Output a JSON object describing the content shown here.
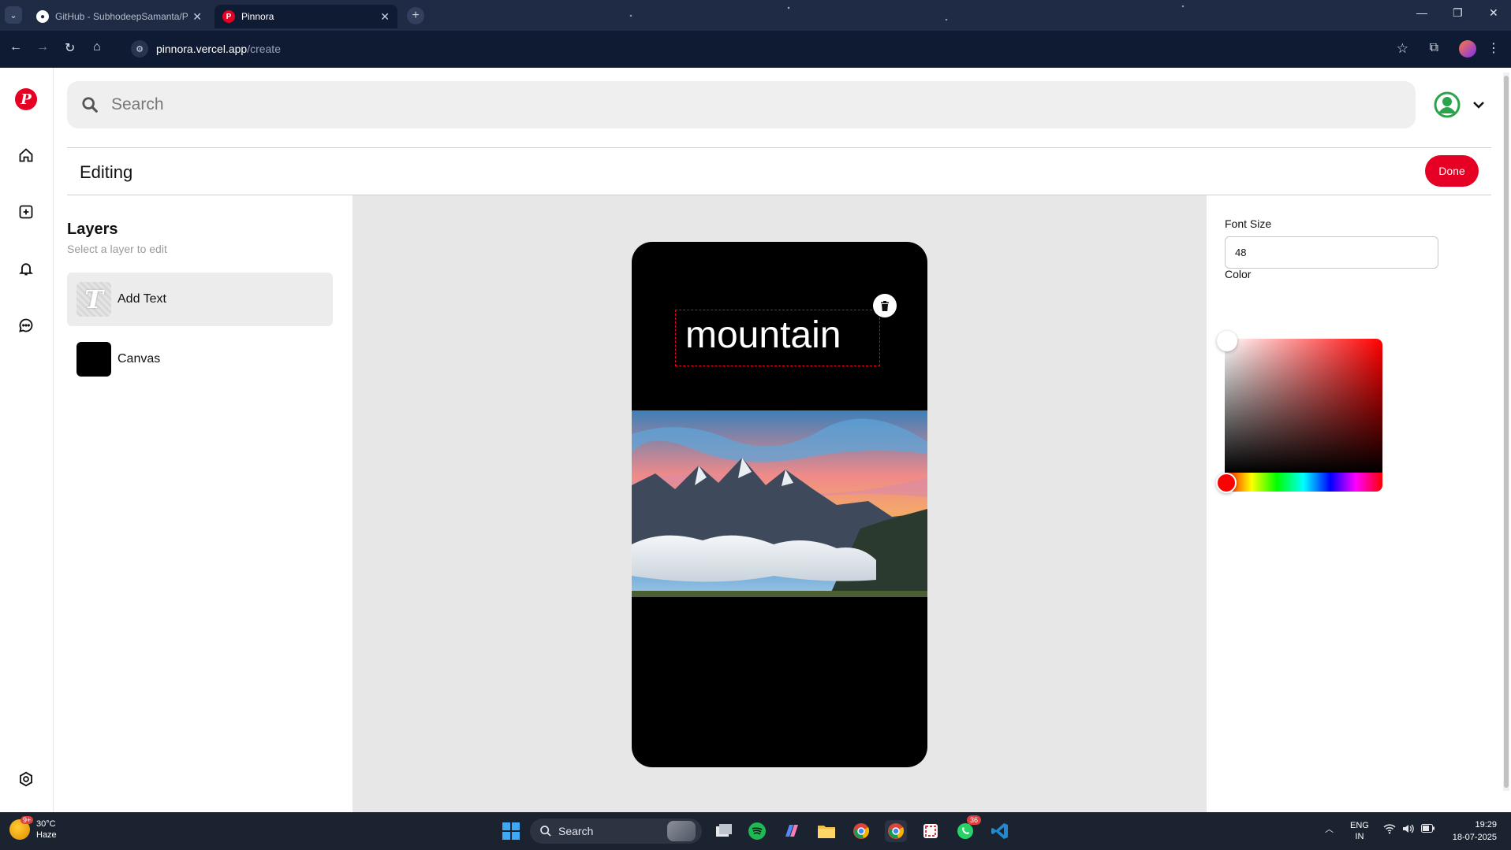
{
  "browser": {
    "tabs": [
      {
        "title": "GitHub - SubhodeepSamanta/P",
        "active": false
      },
      {
        "title": "Pinnora",
        "active": true
      }
    ],
    "url_host": "pinnora.vercel.app",
    "url_path": "/create"
  },
  "app": {
    "search_placeholder": "Search",
    "editing_title": "Editing",
    "done_label": "Done",
    "layers": {
      "title": "Layers",
      "subtitle": "Select a layer to edit",
      "items": [
        {
          "label": "Add Text",
          "selected": true
        },
        {
          "label": "Canvas",
          "selected": false
        }
      ]
    },
    "canvas": {
      "text_layer": "mountain",
      "background": "#000000"
    },
    "properties": {
      "font_size_label": "Font Size",
      "font_size_value": "48",
      "color_label": "Color",
      "selected_color": "#ff0000"
    },
    "accent_color": "#e60023"
  },
  "taskbar": {
    "weather_temp": "30°C",
    "weather_desc": "Haze",
    "weather_badge": "9+",
    "search_label": "Search",
    "whatsapp_badge": "36",
    "lang_top": "ENG",
    "lang_bottom": "IN",
    "time": "19:29",
    "date": "18-07-2025"
  }
}
